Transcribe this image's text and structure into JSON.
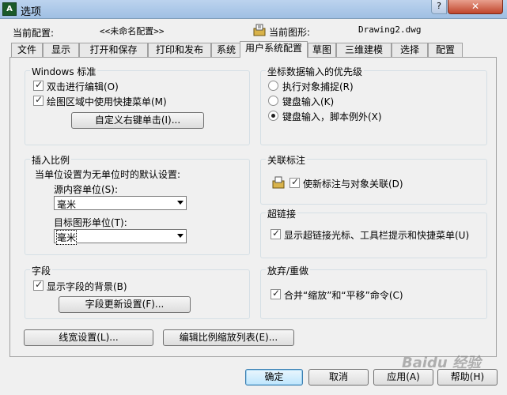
{
  "window": {
    "title": "选项",
    "app_icon": "autocad-icon",
    "help": "?",
    "close": "✕"
  },
  "header": {
    "profile_label": "当前配置:",
    "profile_value": "<<未命名配置>>",
    "drawing_label": "当前图形:",
    "drawing_value": "Drawing2.dwg"
  },
  "tabs": [
    "文件",
    "显示",
    "打开和保存",
    "打印和发布",
    "系统",
    "用户系统配置",
    "草图",
    "三维建模",
    "选择",
    "配置"
  ],
  "active_tab": "用户系统配置",
  "windows_std": {
    "title": "Windows 标准",
    "dblclick_edit": "双击进行编辑(O)",
    "shortcut_menu": "绘图区域中使用快捷菜单(M)",
    "right_click_btn": "自定义右键单击(I)..."
  },
  "coord_input": {
    "title": "坐标数据输入的优先级",
    "opt1": "执行对象捕捉(R)",
    "opt2": "键盘输入(K)",
    "opt3": "键盘输入，脚本例外(X)",
    "selected": 3
  },
  "insert_scale": {
    "title": "插入比例",
    "desc": "当单位设置为无单位时的默认设置:",
    "source_label": "源内容单位(S):",
    "source_value": "毫米",
    "target_label": "目标图形单位(T):",
    "target_value": "毫米"
  },
  "assoc_dim": {
    "title": "关联标注",
    "option": "使新标注与对象关联(D)"
  },
  "hyperlink": {
    "title": "超链接",
    "option": "显示超链接光标、工具栏提示和快捷菜单(U)"
  },
  "fields": {
    "title": "字段",
    "option": "显示字段的背景(B)",
    "btn": "字段更新设置(F)..."
  },
  "undo_redo": {
    "title": "放弃/重做",
    "option": "合并“缩放”和“平移”命令(C)"
  },
  "bottom_buttons": {
    "lineweight": "线宽设置(L)...",
    "scale_list": "编辑比例缩放列表(E)..."
  },
  "footer": {
    "ok": "确定",
    "cancel": "取消",
    "apply": "应用(A)",
    "help": "帮助(H)"
  },
  "watermark": "Baidu 经验"
}
